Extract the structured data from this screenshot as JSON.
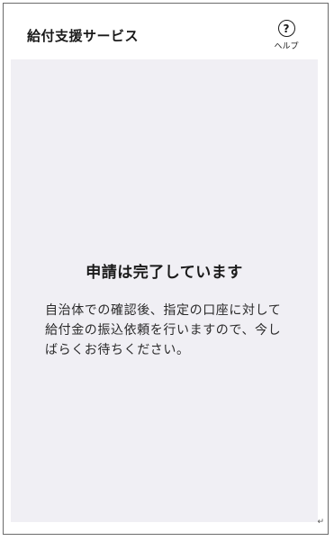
{
  "header": {
    "title": "給付支援サービス",
    "help_icon": "question-circle-icon",
    "help_label": "ヘルプ"
  },
  "content": {
    "title": "申請は完了しています",
    "message": "自治体での確認後、指定の口座に対して給付金の振込依頼を行いますので、今しばらくお待ちください。"
  },
  "footer": {
    "return_mark": "↵"
  },
  "colors": {
    "content_background": "#f0eff4",
    "frame_border": "#6b6b6b",
    "text": "#1a1a1a"
  }
}
